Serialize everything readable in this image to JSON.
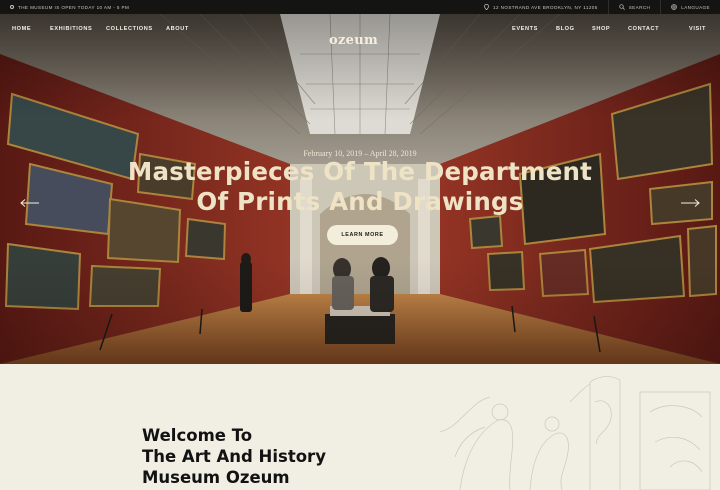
{
  "topbar": {
    "notice": "THE MUSEUM IS OPEN TODAY 10 AM - 5 PM",
    "address": "12 NOSTRAND AVE BROOKLYN, NY 11205",
    "search": "SEARCH",
    "language": "LANGUAGE"
  },
  "nav": {
    "logo": "ozeum",
    "left_items": [
      "HOME",
      "EXHIBITIONS",
      "COLLECTIONS",
      "ABOUT"
    ],
    "right_items": [
      "EVENTS",
      "BLOG",
      "SHOP",
      "CONTACT"
    ],
    "visit": "VISIT"
  },
  "hero": {
    "date": "February 10, 2019 – April 28, 2019",
    "title_line1": "Masterpieces Of The Department",
    "title_line2": "Of Prints And Drawings",
    "button": "LEARN MORE",
    "prev_icon": "arrow-left-icon",
    "next_icon": "arrow-right-icon"
  },
  "intro": {
    "line1": "Welcome To",
    "line2": "The Art And History",
    "line3": "Museum Ozeum"
  },
  "colors": {
    "topbar_bg": "#141412",
    "page_bg": "#f1eee3",
    "wall_red": "#8a2a1f",
    "title": "#efe3c6",
    "button_bg": "#f3eddc"
  }
}
